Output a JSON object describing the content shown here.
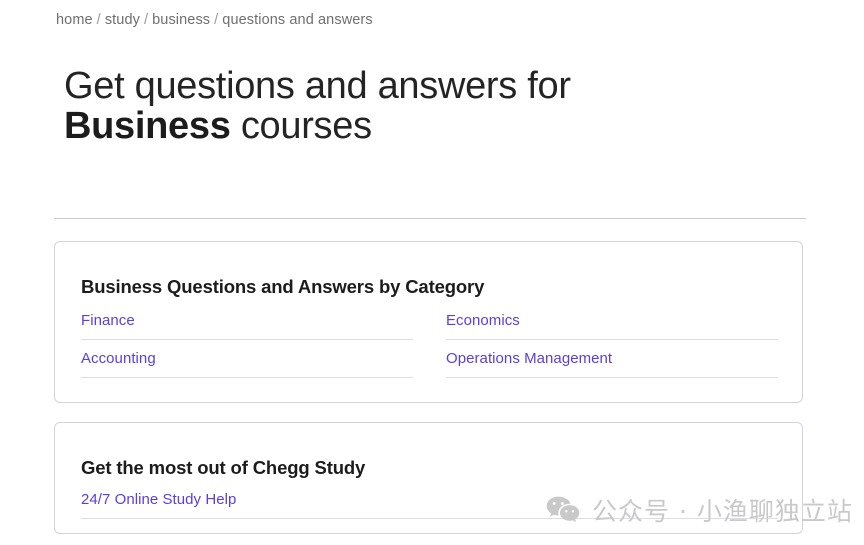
{
  "breadcrumb": {
    "separator": "/",
    "items": [
      {
        "label": "home"
      },
      {
        "label": "study"
      },
      {
        "label": "business"
      },
      {
        "label": "questions and answers"
      }
    ]
  },
  "hero": {
    "line1": "Get questions and answers for",
    "emphasis": "Business",
    "line2_rest": " courses"
  },
  "category_card": {
    "title": "Business Questions and Answers by Category",
    "columns": [
      {
        "items": [
          {
            "label": "Finance"
          },
          {
            "label": "Accounting"
          }
        ]
      },
      {
        "items": [
          {
            "label": "Economics"
          },
          {
            "label": "Operations Management"
          }
        ]
      }
    ]
  },
  "promo_card": {
    "title": "Get the most out of Chegg Study",
    "links": [
      {
        "label": "24/7 Online Study Help"
      }
    ]
  },
  "watermark": {
    "icon": "wechat-icon",
    "text": "公众号 · 小渔聊独立站"
  },
  "colors": {
    "link": "#5c3edc",
    "heading": "#1c1c1c",
    "breadcrumb": "#6f6f6f",
    "border": "#d4d3de",
    "divider": "#dedde5",
    "watermark": "#c9c9c9"
  }
}
